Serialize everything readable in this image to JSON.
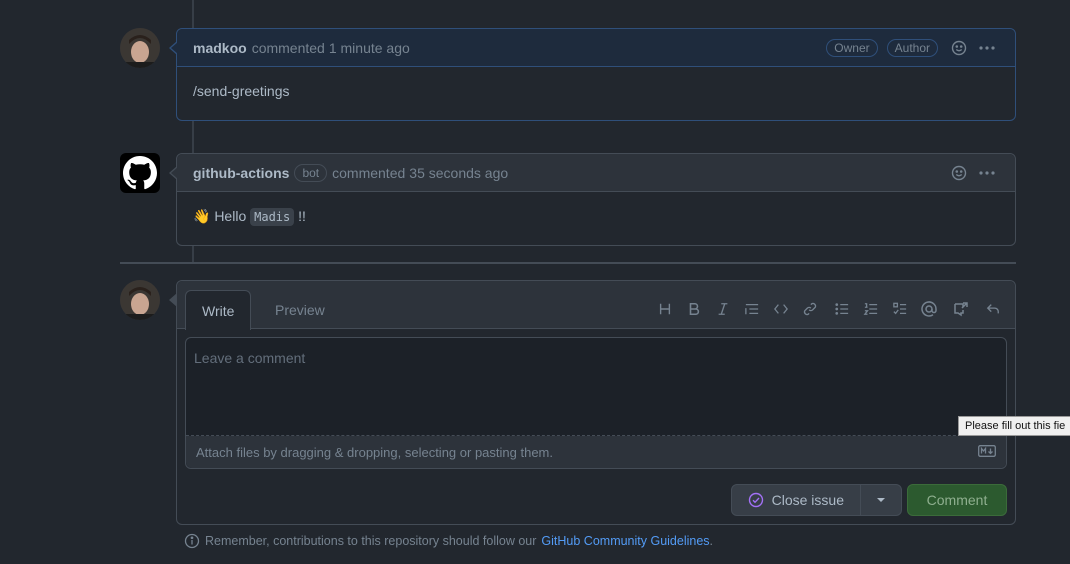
{
  "comments": [
    {
      "author": "madkoo",
      "action": "commented",
      "time": "1 minute ago",
      "labels": [
        "Owner",
        "Author"
      ],
      "body": "/send-greetings"
    },
    {
      "author": "github-actions",
      "badge": "bot",
      "action": "commented",
      "time": "35 seconds ago",
      "body_prefix": "👋 Hello",
      "body_code": "Madis",
      "body_suffix": "!!"
    }
  ],
  "editor": {
    "tabs": [
      "Write",
      "Preview"
    ],
    "placeholder": "Leave a comment",
    "attach_text": "Attach files by dragging & dropping, selecting or pasting them.",
    "toolbar": [
      "heading-icon",
      "bold-icon",
      "italic-icon",
      "quote-icon",
      "code-icon",
      "link-icon",
      "unordered-list-icon",
      "ordered-list-icon",
      "task-list-icon",
      "mention-icon",
      "reference-icon",
      "reply-icon"
    ]
  },
  "actions": {
    "close_label": "Close issue",
    "comment_label": "Comment"
  },
  "tooltip": "Please fill out this fie",
  "footer": {
    "text": "Remember, contributions to this repository should follow our",
    "link": "GitHub Community Guidelines",
    "suffix": "."
  },
  "colors": {
    "background": "#22272e",
    "link": "#539bf5",
    "comment_button": "#2c5a2f",
    "close_icon": "#a371f7"
  }
}
